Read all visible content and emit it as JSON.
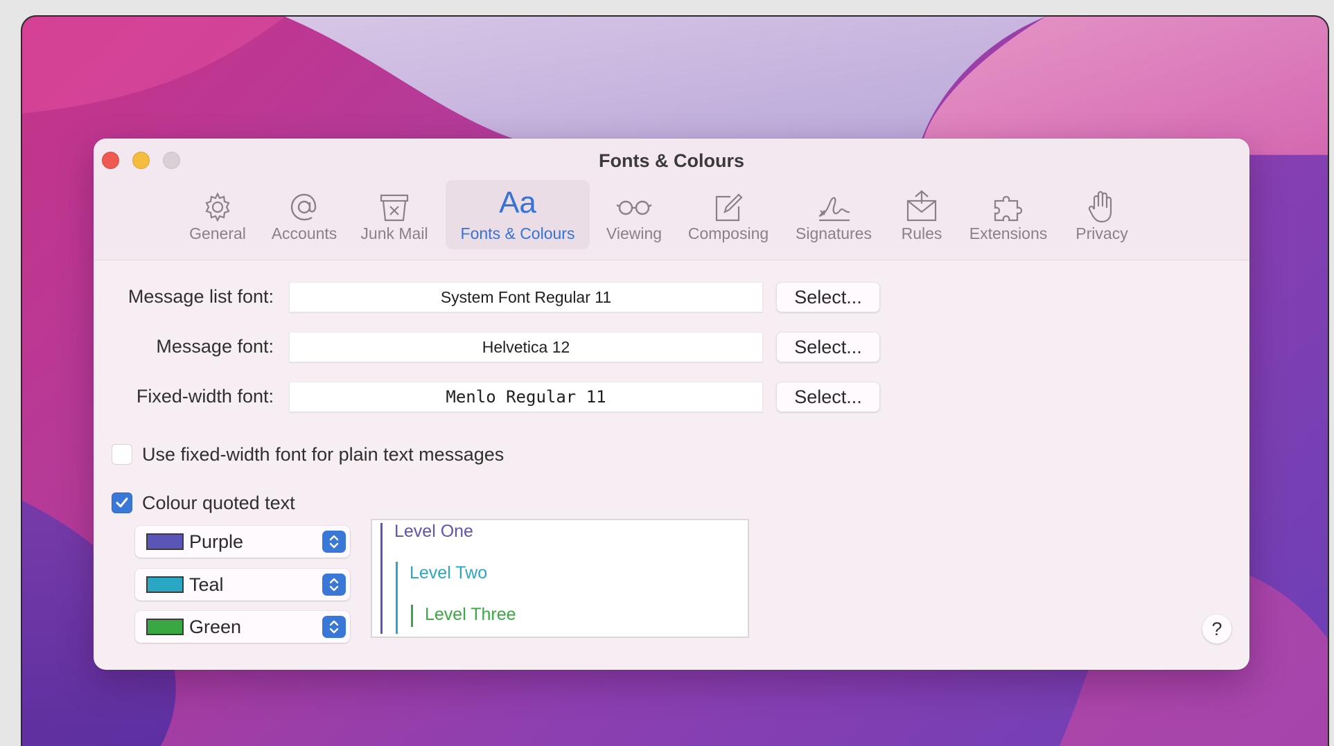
{
  "window": {
    "title": "Fonts & Colours"
  },
  "toolbar": {
    "items": [
      {
        "label": "General",
        "icon": "gear-icon"
      },
      {
        "label": "Accounts",
        "icon": "at-sign-icon"
      },
      {
        "label": "Junk Mail",
        "icon": "junk-bin-icon"
      },
      {
        "label": "Fonts & Colours",
        "icon": "aa-fonts-icon",
        "glyph": "Aa",
        "active": true
      },
      {
        "label": "Viewing",
        "icon": "glasses-icon"
      },
      {
        "label": "Composing",
        "icon": "pencil-square-icon"
      },
      {
        "label": "Signatures",
        "icon": "signature-icon"
      },
      {
        "label": "Rules",
        "icon": "rules-envelope-icon"
      },
      {
        "label": "Extensions",
        "icon": "puzzle-piece-icon"
      },
      {
        "label": "Privacy",
        "icon": "hand-icon"
      }
    ]
  },
  "fonts": {
    "message_list": {
      "label": "Message list font:",
      "value": "System Font Regular 11",
      "button": "Select..."
    },
    "message": {
      "label": "Message font:",
      "value": "Helvetica 12",
      "button": "Select..."
    },
    "fixed_width": {
      "label": "Fixed-width font:",
      "value": "Menlo Regular 11",
      "button": "Select..."
    }
  },
  "options": {
    "use_fixed_width": {
      "label": "Use fixed-width font for plain text messages",
      "checked": false
    },
    "colour_quoted": {
      "label": "Colour quoted text",
      "checked": true
    }
  },
  "quote_colours": [
    {
      "name": "Purple",
      "color": "#5b55b8"
    },
    {
      "name": "Teal",
      "color": "#2aa7c4"
    },
    {
      "name": "Green",
      "color": "#3aa842"
    }
  ],
  "preview": {
    "levels": [
      "Level One",
      "Level Two",
      "Level Three"
    ],
    "colors": {
      "level_one": "#5b55b8",
      "level_two": "#2aa7c4",
      "level_three": "#3aa842"
    }
  },
  "help": {
    "label": "?"
  },
  "colors": {
    "accent": "#3573d9",
    "close": "#ee5a52",
    "minimize": "#f4bd3e",
    "zoom": "#d9d0d5"
  }
}
